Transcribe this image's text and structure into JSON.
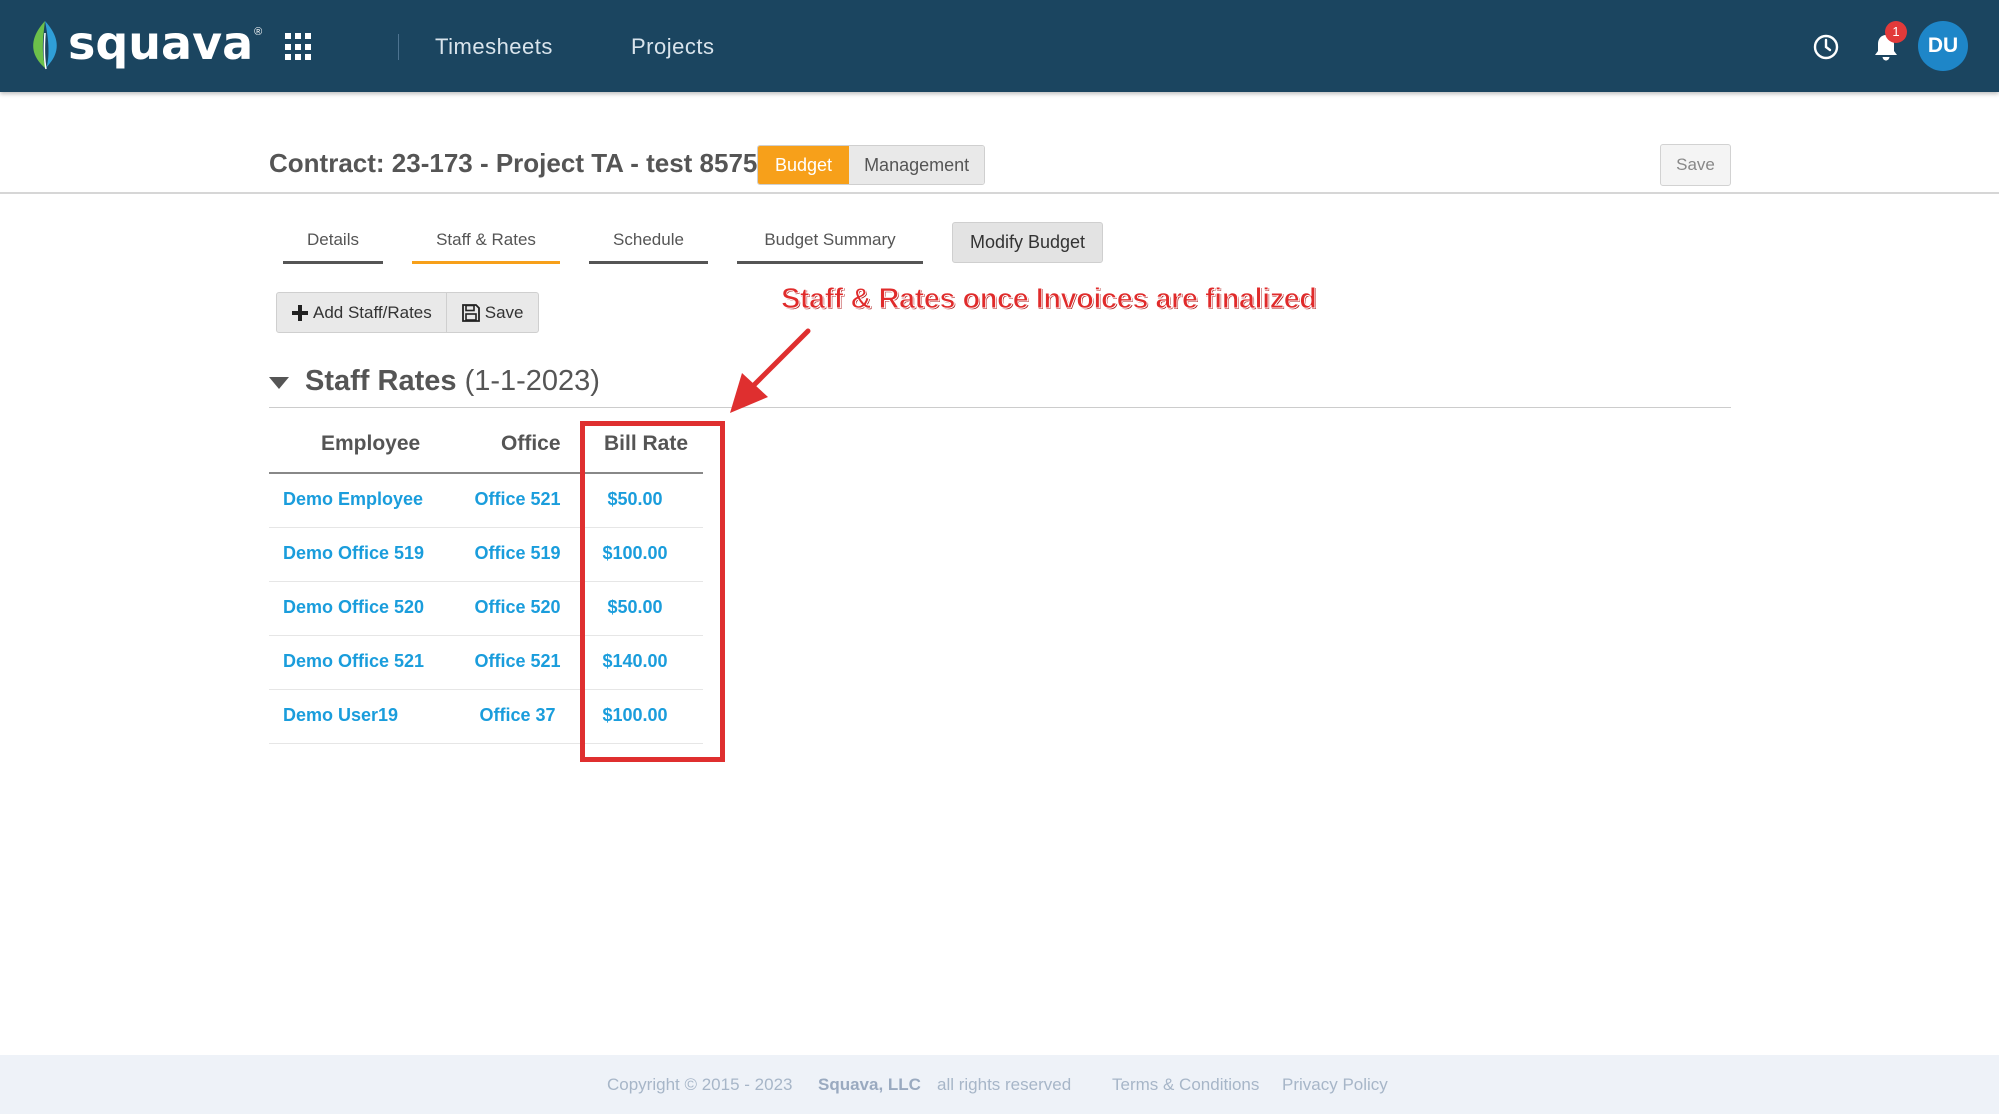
{
  "app": {
    "brand": "squava",
    "brand_mark": "®"
  },
  "nav": {
    "links": [
      {
        "label": "Timesheets"
      },
      {
        "label": "Projects"
      }
    ],
    "notification_count": "1",
    "avatar_initials": "DU"
  },
  "header": {
    "contract_title": "Contract: 23-173 - Project TA - test 8575",
    "mode_budget": "Budget",
    "mode_management": "Management",
    "save_label": "Save"
  },
  "tabs": [
    {
      "label": "Details",
      "active": false
    },
    {
      "label": "Staff & Rates",
      "active": true
    },
    {
      "label": "Schedule",
      "active": false
    },
    {
      "label": "Budget Summary",
      "active": false
    }
  ],
  "modify_budget_label": "Modify Budget",
  "toolbar": {
    "add_label": "Add Staff/Rates",
    "save_label": "Save"
  },
  "section": {
    "title": "Staff Rates",
    "date": "(1-1-2023)"
  },
  "table": {
    "headers": {
      "employee": "Employee",
      "office": "Office",
      "bill_rate": "Bill Rate"
    },
    "rows": [
      {
        "employee": "Demo Employee",
        "office": "Office 521",
        "bill_rate": "$50.00"
      },
      {
        "employee": "Demo Office 519",
        "office": "Office 519",
        "bill_rate": "$100.00"
      },
      {
        "employee": "Demo Office 520",
        "office": "Office 520",
        "bill_rate": "$50.00"
      },
      {
        "employee": "Demo Office 521",
        "office": "Office 521",
        "bill_rate": "$140.00"
      },
      {
        "employee": "Demo User19",
        "office": "Office 37",
        "bill_rate": "$100.00"
      }
    ]
  },
  "annotation": {
    "text": "Staff & Rates once Invoices are finalized",
    "color": "#df2f2f"
  },
  "footer": {
    "copyright": "Copyright © 2015 - 2023",
    "company": "Squava, LLC",
    "rights": "all rights reserved",
    "terms": "Terms & Conditions",
    "privacy": "Privacy Policy"
  },
  "colors": {
    "navbar": "#1b4560",
    "accent": "#f7a01a",
    "link": "#1a9ddc"
  }
}
